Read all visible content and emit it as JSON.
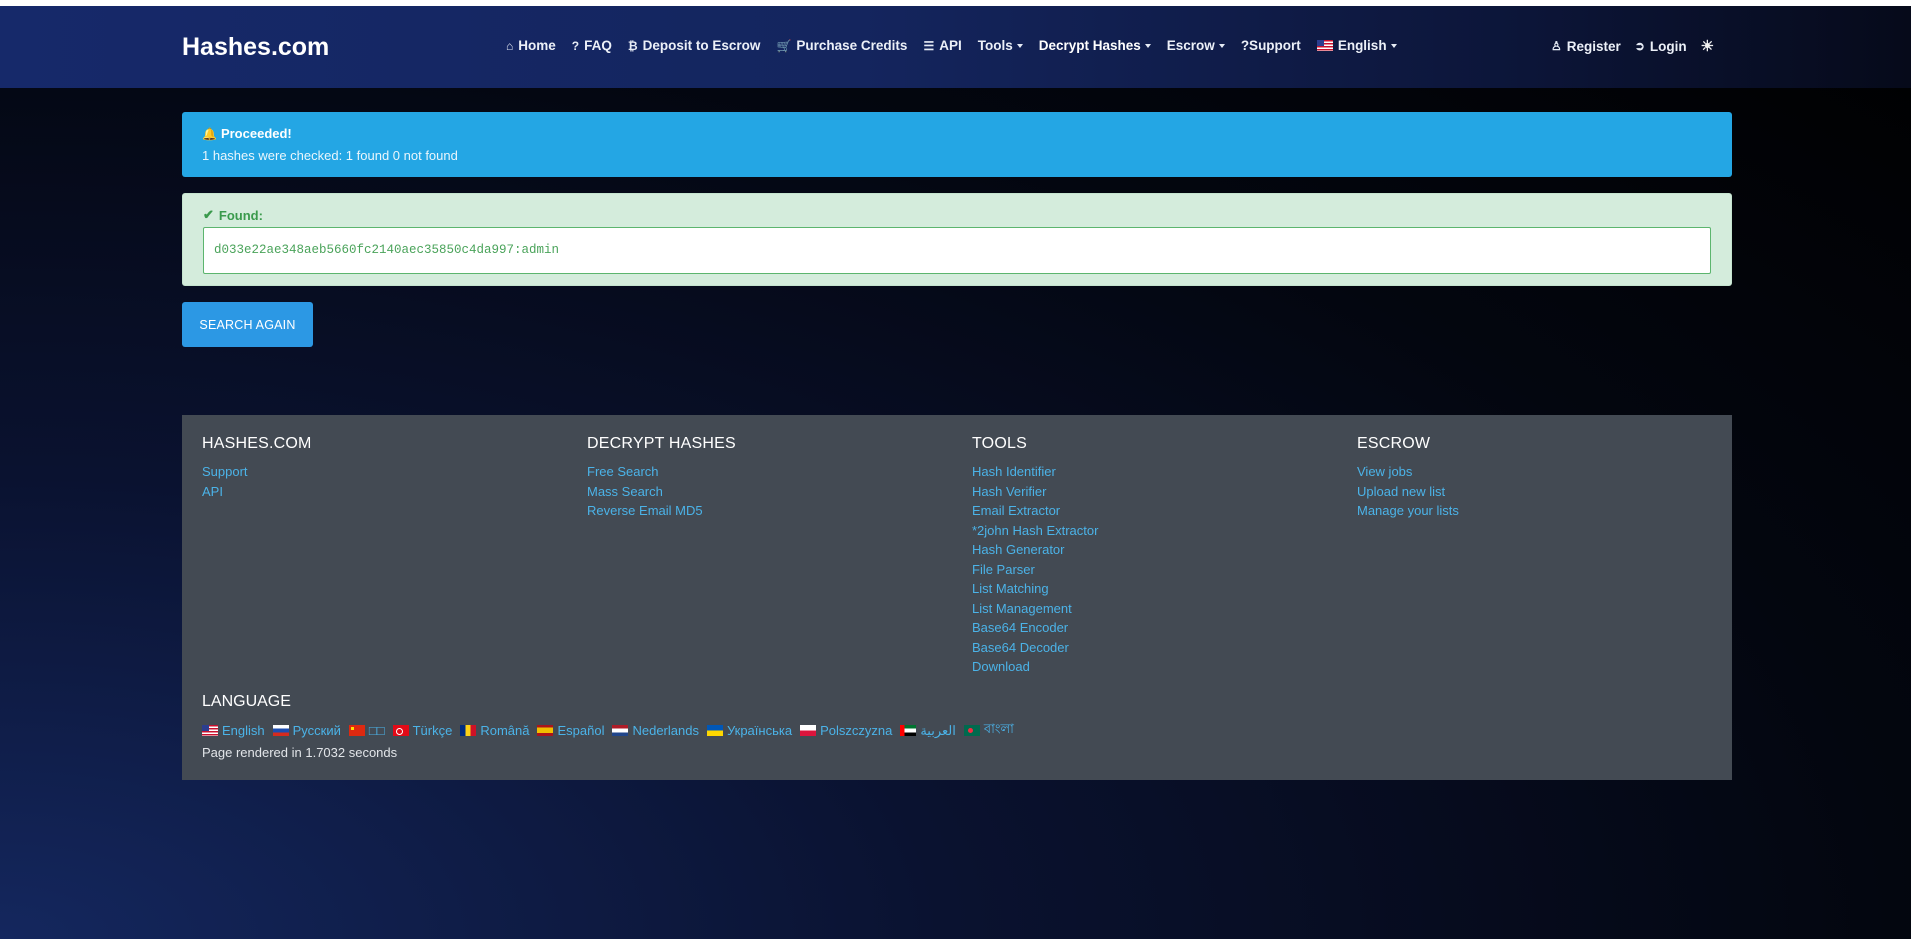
{
  "brand": "Hashes.com",
  "nav": {
    "items": [
      {
        "icon": "home-icon",
        "label": "Home"
      },
      {
        "icon": "question-icon",
        "label": "FAQ"
      },
      {
        "icon": "bitcoin-icon",
        "label": "Deposit to Escrow"
      },
      {
        "icon": "cart-icon",
        "label": "Purchase Credits"
      },
      {
        "icon": "api-icon",
        "label": "API"
      },
      {
        "label": "Tools"
      },
      {
        "label": "Decrypt Hashes"
      },
      {
        "label": "Escrow"
      },
      {
        "label": "?Support"
      },
      {
        "label": "English"
      }
    ],
    "register": "Register",
    "login": "Login"
  },
  "alert_info": {
    "title": "Proceeded!",
    "text": "1 hashes were checked: 1 found 0 not found"
  },
  "found": {
    "label": "Found:",
    "value": "d033e22ae348aeb5660fc2140aec35850c4da997:admin"
  },
  "search_again": "SEARCH AGAIN",
  "footer": {
    "columns": [
      {
        "title": "HASHES.COM",
        "links": [
          "Support",
          "API"
        ]
      },
      {
        "title": "DECRYPT HASHES",
        "links": [
          "Free Search",
          "Mass Search",
          "Reverse Email MD5"
        ]
      },
      {
        "title": "TOOLS",
        "links": [
          "Hash Identifier",
          "Hash Verifier",
          "Email Extractor",
          "*2john Hash Extractor",
          "Hash Generator",
          "File Parser",
          "List Matching",
          "List Management",
          "Base64 Encoder",
          "Base64 Decoder",
          "Download"
        ]
      },
      {
        "title": "ESCROW",
        "links": [
          "View jobs",
          "Upload new list",
          "Manage your lists"
        ]
      }
    ],
    "language_title": "LANGUAGE",
    "languages": [
      "English",
      "Русский",
      "□□",
      "Türkçe",
      "Română",
      "Español",
      "Nederlands",
      "Українська",
      "Polszczyzna",
      "العربية",
      "বাংলা"
    ],
    "rendered": "Page rendered in 1.7032 seconds"
  }
}
